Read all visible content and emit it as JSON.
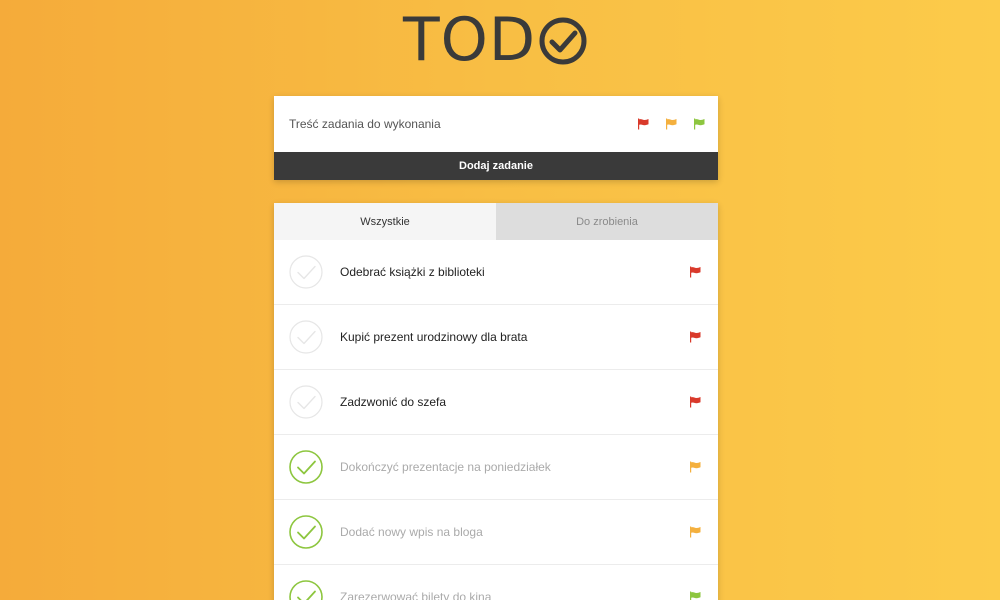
{
  "app": {
    "logo_text": "TOD",
    "logo_icon": "check-circle-icon"
  },
  "new_task": {
    "placeholder": "Treść zadania do wykonania",
    "value": "",
    "priority_flags": [
      {
        "name": "high",
        "color": "#d93a2b"
      },
      {
        "name": "medium",
        "color": "#f4b03e"
      },
      {
        "name": "low",
        "color": "#8dc63f"
      }
    ],
    "add_button_label": "Dodaj zadanie"
  },
  "tabs": [
    {
      "label": "Wszystkie",
      "active": true
    },
    {
      "label": "Do zrobienia",
      "active": false
    }
  ],
  "tasks": [
    {
      "text": "Odebrać książki z biblioteki",
      "done": false,
      "flag_color": "#d93a2b"
    },
    {
      "text": "Kupić prezent urodzinowy dla brata",
      "done": false,
      "flag_color": "#d93a2b"
    },
    {
      "text": "Zadzwonić do szefa",
      "done": false,
      "flag_color": "#d93a2b"
    },
    {
      "text": "Dokończyć prezentacje na poniedziałek",
      "done": true,
      "flag_color": "#f4b03e"
    },
    {
      "text": "Dodać nowy wpis na bloga",
      "done": true,
      "flag_color": "#f4b03e"
    },
    {
      "text": "Zarezerwować bilety do kina",
      "done": true,
      "flag_color": "#8dc63f"
    }
  ],
  "colors": {
    "check_done": "#8dc63f",
    "check_undone": "#e6e6e6",
    "dark": "#3a3a3a"
  }
}
